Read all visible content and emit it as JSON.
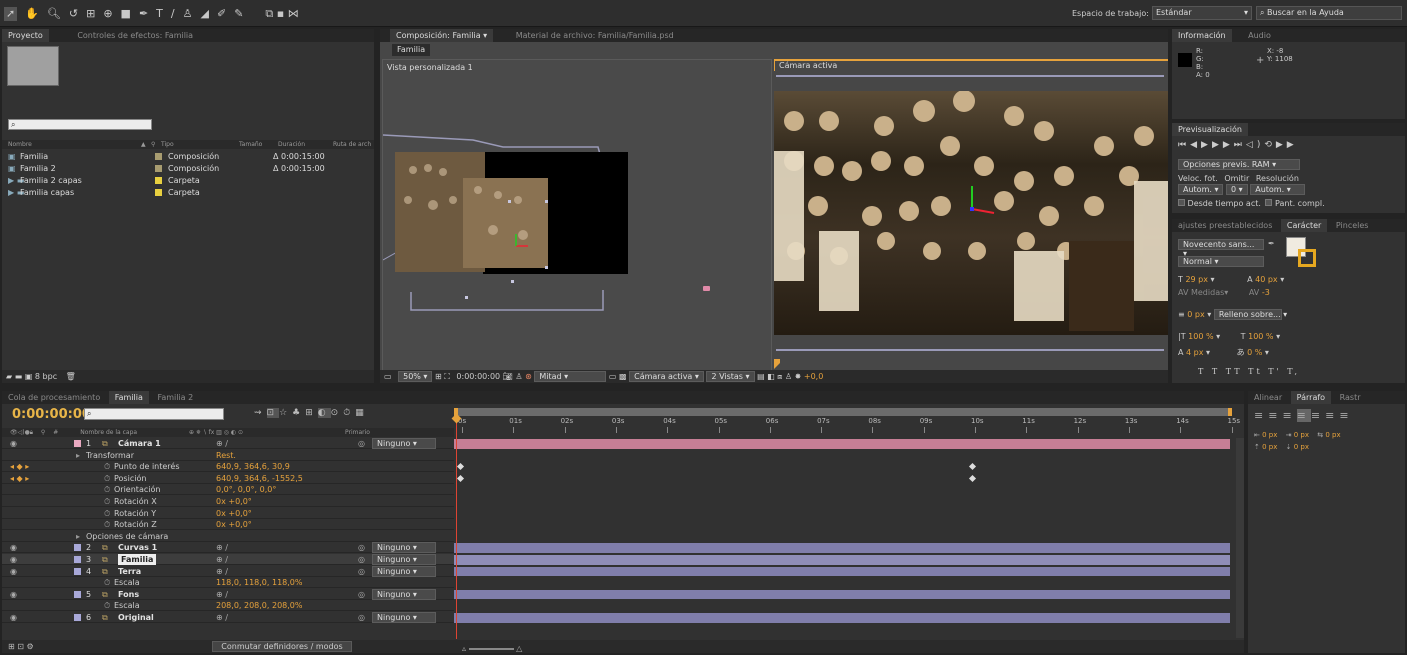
{
  "toolbar": {
    "workspace_label": "Espacio de trabajo:",
    "workspace_value": "Estándar",
    "help_placeholder": "Buscar en la Ayuda"
  },
  "project": {
    "tab_project": "Proyecto",
    "tab_effects": "Controles de efectos: Familia",
    "columns": [
      "Nombre",
      "Tipo",
      "Tamaño",
      "Duración",
      "Ruta de arch"
    ],
    "items": [
      {
        "name": "Familia",
        "type": "Composición",
        "duration": "Δ 0:00:15:00",
        "kind": "comp"
      },
      {
        "name": "Familia 2",
        "type": "Composición",
        "duration": "Δ 0:00:15:00",
        "kind": "comp"
      },
      {
        "name": "Familia 2 capas",
        "type": "Carpeta",
        "duration": "",
        "kind": "folder"
      },
      {
        "name": "Familia capas",
        "type": "Carpeta",
        "duration": "",
        "kind": "folder"
      }
    ],
    "bpc": "8 bpc"
  },
  "comp": {
    "tab_comp": "Composición: Familia",
    "tab_footage": "Material de archivo: Familia/Familia.psd",
    "breadcrumb": "Familia",
    "left_view": "Vista personalizada 1",
    "right_view": "Cámara activa",
    "zoom": "50%",
    "timecode": "0:00:00:00",
    "resolution": "Mitad",
    "camera": "Cámara activa",
    "views": "2 Vistas",
    "exposure": "+0,0"
  },
  "info": {
    "tab_info": "Información",
    "tab_audio": "Audio",
    "r": "R:",
    "g": "G:",
    "b": "B:",
    "a": "A: 0",
    "x": "X: -8",
    "y": "Y: 1108"
  },
  "preview": {
    "tab": "Previsualización",
    "options": "Opciones previs. RAM",
    "fps_label": "Veloc. fot.",
    "skip_label": "Omitir",
    "res_label": "Resolución",
    "fps": "Autom.",
    "skip": "0",
    "res": "Autom.",
    "from_current": "Desde tiempo act.",
    "fullscreen": "Pant. compl."
  },
  "character": {
    "tab_presets": "ajustes preestablecidos",
    "tab_char": "Carácter",
    "tab_brush": "Pinceles",
    "font": "Novecento sans...",
    "style": "Normal",
    "size": "29 px",
    "leading": "40 px",
    "kerning": "Medidas",
    "tracking": "-3",
    "stroke": "0 px",
    "stroke_mode": "Relleno sobre...",
    "vscale": "100 %",
    "hscale": "100 %",
    "baseline": "4 px",
    "tsume": "0 %",
    "styles": "T T TT Tt T' T,",
    "fill_color": "#f0ebe0",
    "stroke_color": "#e6a820"
  },
  "paragraph": {
    "tab_align": "Alinear",
    "tab_para": "Párrafo",
    "tab_raster": "Rastr",
    "indent_left": "0 px",
    "indent_right": "0 px",
    "indent_first": "0 px",
    "space_before": "0 px",
    "space_after": "0 px"
  },
  "timeline": {
    "tab_queue": "Cola de procesamiento",
    "tab_familia": "Familia",
    "tab_familia2": "Familia 2",
    "timecode": "0:00:00:00",
    "col_layer": "Nombre de la capa",
    "col_parent": "Primario",
    "ticks": [
      "0s",
      "01s",
      "02s",
      "03s",
      "04s",
      "05s",
      "06s",
      "07s",
      "08s",
      "09s",
      "10s",
      "11s",
      "12s",
      "13s",
      "14s",
      "15s"
    ],
    "toggle_modes": "Conmutar definidores / modos",
    "rows": [
      {
        "num": "1",
        "name": "Cámara 1",
        "indent": 0,
        "kind": "layer",
        "parent": "Ninguno",
        "color": "#e8a8c0",
        "bar": "pink"
      },
      {
        "num": "",
        "name": "Transformar",
        "indent": 1,
        "kind": "group",
        "value": "Rest."
      },
      {
        "num": "",
        "name": "Punto de interés",
        "indent": 2,
        "kind": "prop",
        "value": "640,9, 364,6, 30,9"
      },
      {
        "num": "",
        "name": "Posición",
        "indent": 2,
        "kind": "prop",
        "value": "640,9, 364,6, -1552,5"
      },
      {
        "num": "",
        "name": "Orientación",
        "indent": 2,
        "kind": "prop",
        "value": "0,0°, 0,0°, 0,0°"
      },
      {
        "num": "",
        "name": "Rotación X",
        "indent": 2,
        "kind": "prop",
        "value": "0x +0,0°"
      },
      {
        "num": "",
        "name": "Rotación Y",
        "indent": 2,
        "kind": "prop",
        "value": "0x +0,0°"
      },
      {
        "num": "",
        "name": "Rotación Z",
        "indent": 2,
        "kind": "prop",
        "value": "0x +0,0°"
      },
      {
        "num": "",
        "name": "Opciones de cámara",
        "indent": 1,
        "kind": "group",
        "value": ""
      },
      {
        "num": "2",
        "name": "Curvas 1",
        "indent": 0,
        "kind": "layer",
        "parent": "Ninguno",
        "color": "#a8a8d8",
        "bar": "purple"
      },
      {
        "num": "3",
        "name": "Familia",
        "indent": 0,
        "kind": "layer",
        "parent": "Ninguno",
        "color": "#a8a8d8",
        "bar": "purple",
        "selected": true
      },
      {
        "num": "4",
        "name": "Terra",
        "indent": 0,
        "kind": "layer",
        "parent": "Ninguno",
        "color": "#a8a8d8",
        "bar": "purple"
      },
      {
        "num": "",
        "name": "Escala",
        "indent": 2,
        "kind": "prop",
        "value": "118,0, 118,0, 118,0%"
      },
      {
        "num": "5",
        "name": "Fons",
        "indent": 0,
        "kind": "layer",
        "parent": "Ninguno",
        "color": "#a8a8d8",
        "bar": "purple"
      },
      {
        "num": "",
        "name": "Escala",
        "indent": 2,
        "kind": "prop",
        "value": "208,0, 208,0, 208,0%"
      },
      {
        "num": "6",
        "name": "Original",
        "indent": 0,
        "kind": "layer",
        "parent": "Ninguno",
        "color": "#a8a8d8",
        "bar": "purple"
      }
    ]
  },
  "colors": {
    "accent": "#e6a23c",
    "camera_bar": "#c67e95",
    "layer_bar": "#807eab",
    "playhead": "#e6a23c"
  }
}
